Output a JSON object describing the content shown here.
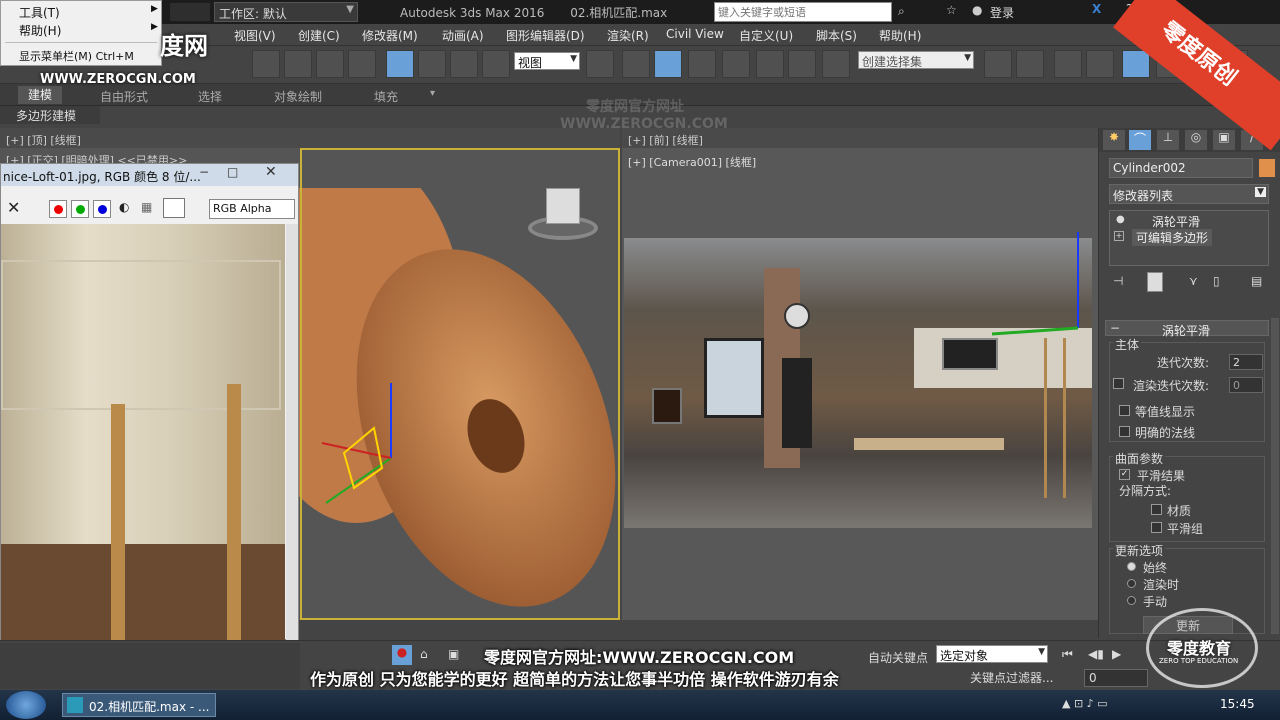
{
  "titlebar": {
    "workspace_label": "工作区: 默认",
    "app_title": "Autodesk 3ds Max 2016",
    "file_title": "02.相机匹配.max",
    "search_placeholder": "键入关键字或短语",
    "login_label": "登录"
  },
  "context_menu": {
    "items": [
      "工具(T)",
      "帮助(H)",
      "显示菜单栏(M) Ctrl+M"
    ]
  },
  "menubar": {
    "items": [
      "视图(V)",
      "创建(C)",
      "修改器(M)",
      "动画(A)",
      "图形编辑器(D)",
      "渲染(R)",
      "Civil View",
      "自定义(U)",
      "脚本(S)",
      "帮助(H)"
    ]
  },
  "toolbar": {
    "ref_coord": "视图",
    "named_selection": "创建选择集"
  },
  "ribbon": {
    "tabs": [
      "建模",
      "自由形式",
      "选择",
      "对象绘制",
      "填充"
    ],
    "sub_label": "多边形建模"
  },
  "viewports": {
    "left_label": "[+] [正交] [明暗处理] <<已禁用>>",
    "top_left_label": "[+] [顶] [线框]",
    "top_right_label": "[+] [前] [线框]",
    "camera_label": "[+] [Camera001] [线框]"
  },
  "image_window": {
    "title": "nice-Loft-01.jpg, RGB 颜色 8 位/...",
    "channel": "RGB Alpha"
  },
  "command_panel": {
    "object_name": "Cylinder002",
    "modifier_list": "修改器列表",
    "stack": [
      "涡轮平滑",
      "可编辑多边形"
    ],
    "rollout_title": "涡轮平滑",
    "main_group": "主体",
    "iterations_label": "迭代次数:",
    "iterations_value": "2",
    "render_iters_label": "渲染迭代次数:",
    "render_iters_value": "0",
    "isoline_label": "等值线显示",
    "explicit_normals_label": "明确的法线",
    "surface_group": "曲面参数",
    "smooth_result_label": "平滑结果",
    "separate_label": "分隔方式:",
    "materials_label": "材质",
    "smoothing_groups_label": "平滑组",
    "update_group": "更新选项",
    "always_label": "始终",
    "when_rendering_label": "渲染时",
    "manually_label": "手动",
    "update_button": "更新"
  },
  "bottombar": {
    "auto_key": "自动关键点",
    "selected_object": "选定对象",
    "key_filters": "关键点过滤器...",
    "frame": "0"
  },
  "taskbar": {
    "task_label": "02.相机匹配.max - ...",
    "clock": "15:45"
  },
  "watermarks": {
    "site": "WWW.ZEROCGN.COM",
    "brand_cn": "零度网官方网址",
    "corner_badge": "零度原创",
    "edu_badge": "零度教育",
    "edu_en": "ZERO TOP EDUCATION"
  },
  "subtitles": {
    "line1": "零度网官方网址:WWW.ZEROCGN.COM",
    "line2": "作为原创 只为您能学的更好 超简单的方法让您事半功倍 操作软件游刃有余"
  },
  "colors": {
    "accent_blue": "#6aa0d8",
    "object_orange": "#c8804a",
    "badge_red": "#e0402a"
  }
}
